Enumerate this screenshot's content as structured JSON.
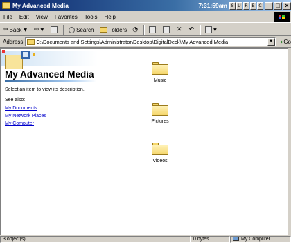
{
  "window": {
    "title": "My Advanced Media",
    "clock": "7:31:59am",
    "mini_buttons": [
      "S",
      "U",
      "R",
      "B",
      "C"
    ]
  },
  "menu": {
    "items": [
      {
        "label": "File"
      },
      {
        "label": "Edit"
      },
      {
        "label": "View"
      },
      {
        "label": "Favorites"
      },
      {
        "label": "Tools"
      },
      {
        "label": "Help"
      }
    ]
  },
  "toolbar": {
    "back": "Back",
    "search": "Search",
    "folders": "Folders"
  },
  "address": {
    "label": "Address",
    "path": "C:\\Documents and Settings\\Administrator\\Desktop\\DigitalDeck\\My Advanced Media",
    "go": "Go"
  },
  "info_pane": {
    "title": "My Advanced Media",
    "description": "Select an item to view its description.",
    "see_also": "See also:",
    "links": [
      "My Documents",
      "My Network Places",
      "My Computer"
    ]
  },
  "files": [
    {
      "name": "Music"
    },
    {
      "name": "Pictures"
    },
    {
      "name": "Videos"
    }
  ],
  "status": {
    "objects": "3 object(s)",
    "size": "0 bytes",
    "zone": "My Computer"
  }
}
